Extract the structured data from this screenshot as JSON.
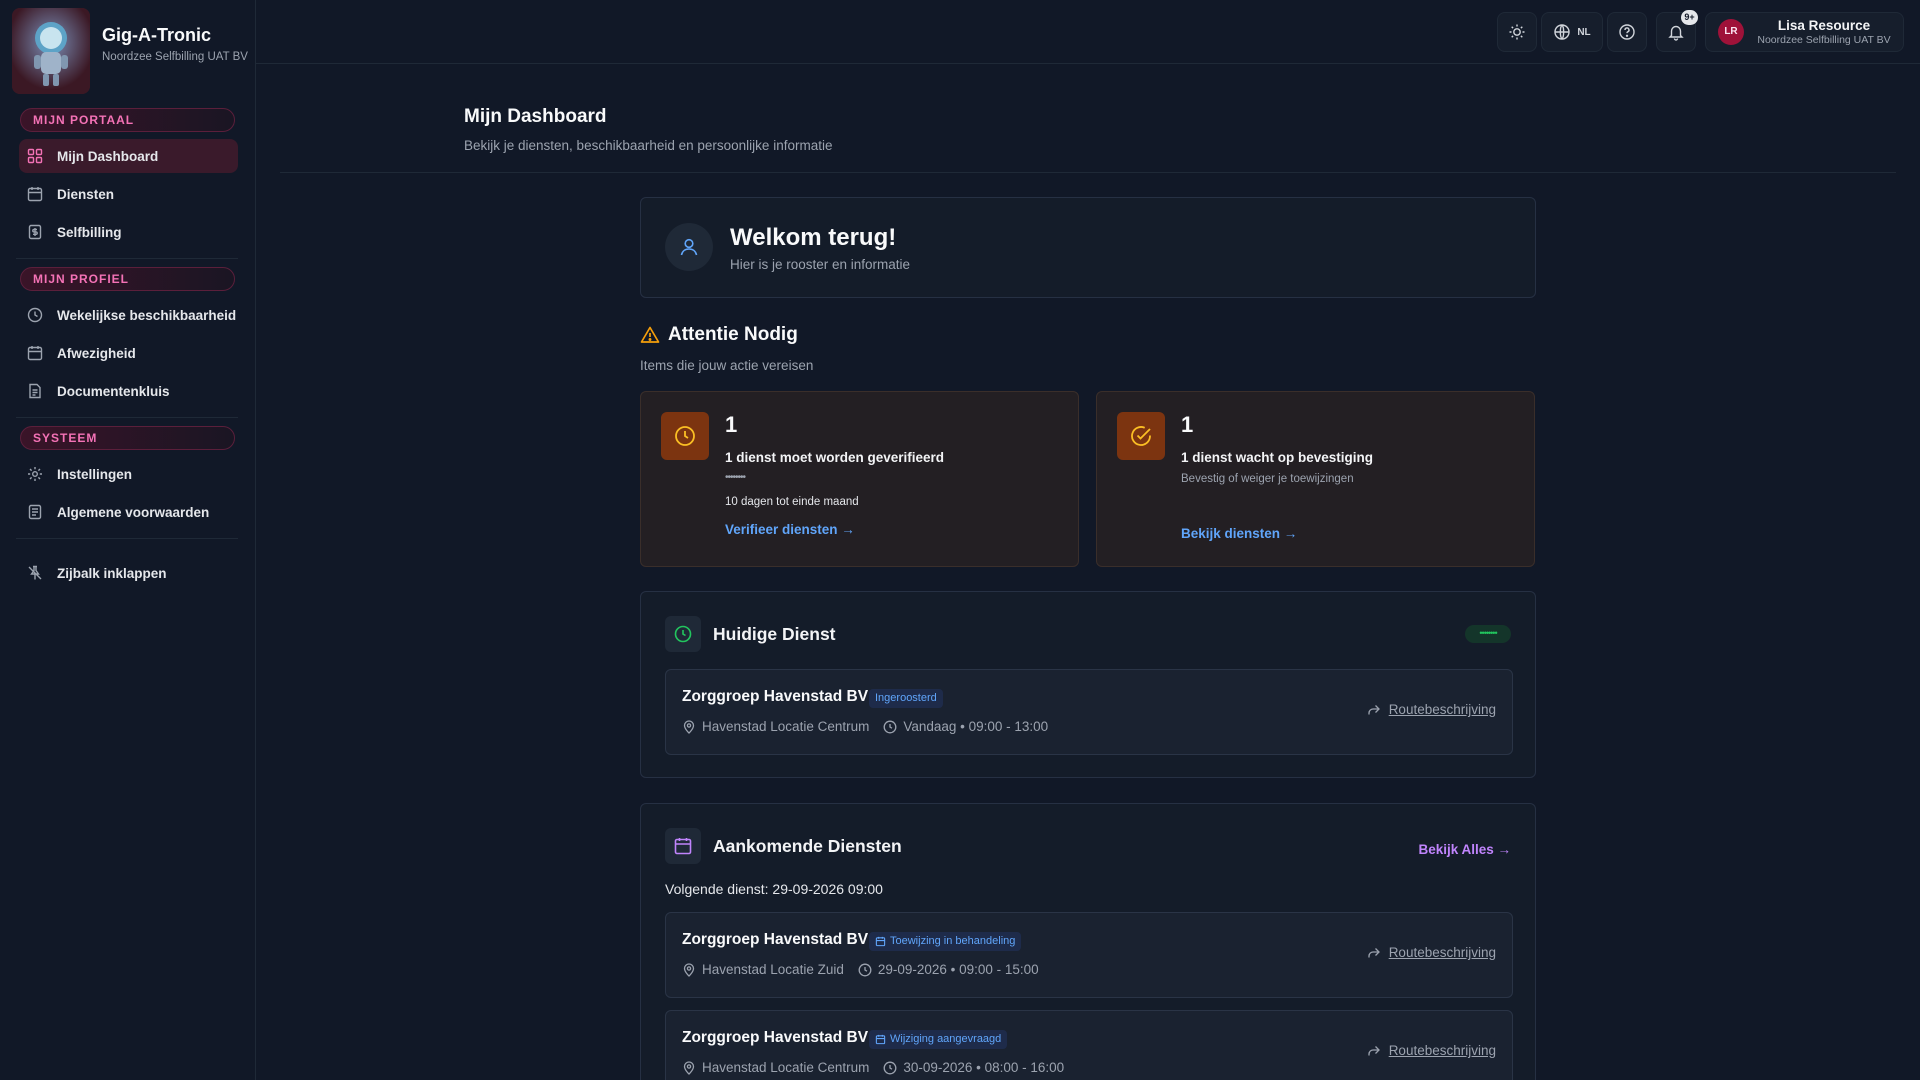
{
  "brand": {
    "name": "Gig-A-Tronic",
    "org": "Noordzee Selfbilling UAT BV"
  },
  "sidebar": {
    "sections": [
      {
        "label": "MIJN PORTAAL",
        "items": [
          {
            "label": "Mijn Dashboard",
            "icon": "dashboard-icon",
            "active": true
          },
          {
            "label": "Diensten",
            "icon": "calendar-icon"
          },
          {
            "label": "Selfbilling",
            "icon": "invoice-icon"
          }
        ]
      },
      {
        "label": "MIJN PROFIEL",
        "items": [
          {
            "label": "Wekelijkse beschikbaarheid",
            "icon": "clock-icon"
          },
          {
            "label": "Afwezigheid",
            "icon": "calendar-icon"
          },
          {
            "label": "Documentenkluis",
            "icon": "document-icon"
          }
        ]
      },
      {
        "label": "SYSTEEM",
        "items": [
          {
            "label": "Instellingen",
            "icon": "gear-icon"
          },
          {
            "label": "Algemene voorwaarden",
            "icon": "terms-icon"
          }
        ]
      }
    ],
    "collapse_label": "Zijbalk inklappen"
  },
  "topbar": {
    "language": "NL",
    "notifications_badge": "9+",
    "user": {
      "initials": "LR",
      "name": "Lisa Resource",
      "org": "Noordzee Selfbilling UAT BV"
    }
  },
  "page": {
    "title": "Mijn Dashboard",
    "subtitle": "Bekijk je diensten, beschikbaarheid en persoonlijke informatie"
  },
  "welcome": {
    "title": "Welkom terug!",
    "subtitle": "Hier is je rooster en informatie"
  },
  "attention": {
    "title": "Attentie Nodig",
    "subtitle": "Items die jouw actie vereisen",
    "cards": [
      {
        "count": "1",
        "title": "1 dienst moet worden geverifieerd",
        "masked": "••••••••",
        "detail": "10 dagen tot einde maand",
        "link": "Verifieer diensten →"
      },
      {
        "count": "1",
        "title": "1 dienst wacht op bevestiging",
        "detail": "Bevestig of weiger je toewijzingen",
        "link": "Bekijk diensten →"
      }
    ]
  },
  "current": {
    "title": "Huidige Dienst",
    "status": "••••••••",
    "shift": {
      "org": "Zorggroep Havenstad BV",
      "tag": "Ingeroosterd",
      "location": "Havenstad Locatie Centrum",
      "time": "Vandaag • 09:00 - 13:00",
      "route": "Routebeschrijving"
    }
  },
  "upcoming": {
    "title": "Aankomende Diensten",
    "view_all": "Bekijk Alles →",
    "next": "Volgende dienst: 29-09-2026 09:00",
    "shifts": [
      {
        "org": "Zorggroep Havenstad BV",
        "tag": "Toewijzing in behandeling",
        "location": "Havenstad Locatie Zuid",
        "time": "29-09-2026 • 09:00 - 15:00",
        "route": "Routebeschrijving"
      },
      {
        "org": "Zorggroep Havenstad BV",
        "tag": "Wijziging aangevraagd",
        "location": "Havenstad Locatie Centrum",
        "time": "30-09-2026 • 08:00 - 16:00",
        "route": "Routebeschrijving"
      }
    ]
  },
  "colors": {
    "accent_pink": "#f472b6",
    "link_blue": "#60a5fa",
    "warning_orange": "#f59e0b",
    "success_green": "#22c55e",
    "purple": "#c084fc"
  }
}
